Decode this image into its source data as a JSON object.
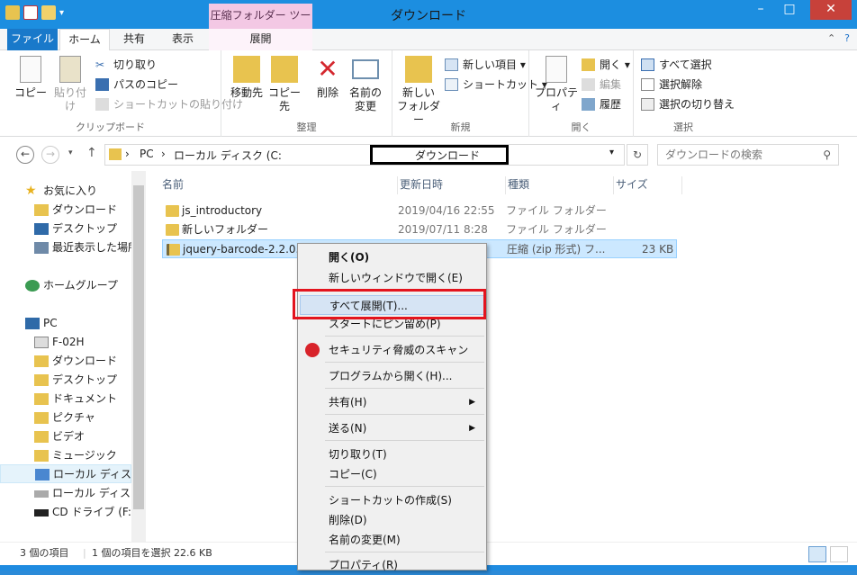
{
  "window": {
    "title": "ダウンロード",
    "context_tab_header": "圧縮フォルダー ツール"
  },
  "tabs": {
    "file": "ファイル",
    "home": "ホーム",
    "share": "共有",
    "view": "表示",
    "extract": "展開"
  },
  "ribbon": {
    "clipboard": {
      "label": "クリップボード",
      "copy": "コピー",
      "paste": "貼り付け",
      "cut": "切り取り",
      "copy_path": "パスのコピー",
      "paste_shortcut": "ショートカットの貼り付け"
    },
    "organize": {
      "label": "整理",
      "move_to": "移動先",
      "copy_to": "コピー先",
      "delete": "削除",
      "rename_l1": "名前の",
      "rename_l2": "変更"
    },
    "new": {
      "label": "新規",
      "new_folder_l1": "新しい",
      "new_folder_l2": "フォルダー",
      "new_item": "新しい項目",
      "shortcut": "ショートカット"
    },
    "open": {
      "label": "開く",
      "properties": "プロパティ",
      "open": "開く",
      "edit": "編集",
      "history": "履歴"
    },
    "select": {
      "label": "選択",
      "select_all": "すべて選択",
      "select_none": "選択解除",
      "invert": "選択の切り替え"
    }
  },
  "address": {
    "pc": "PC",
    "disk": "ローカル ディスク (C:",
    "folder": "ダウンロード",
    "search_placeholder": "ダウンロードの検索"
  },
  "nav": {
    "favorites": "お気に入り",
    "downloads": "ダウンロード",
    "desktop": "デスクトップ",
    "recent": "最近表示した場所",
    "homegroup": "ホームグループ",
    "pc": "PC",
    "f02h": "F-02H",
    "pc_downloads": "ダウンロード",
    "pc_desktop": "デスクトップ",
    "documents": "ドキュメント",
    "pictures": "ピクチャ",
    "videos": "ビデオ",
    "music": "ミュージック",
    "local_disk_1": "ローカル ディスク (",
    "local_disk_2": "ローカル ディスク (",
    "cd_drive": "CD ドライブ (F:)"
  },
  "columns": {
    "name": "名前",
    "date": "更新日時",
    "type": "種類",
    "size": "サイズ"
  },
  "files": [
    {
      "name": "js_introductory",
      "date": "2019/04/16 22:55",
      "type": "ファイル フォルダー",
      "size": ""
    },
    {
      "name": "新しいフォルダー",
      "date": "2019/07/11 8:28",
      "type": "ファイル フォルダー",
      "size": ""
    },
    {
      "name": "jquery-barcode-2.2.0.",
      "date": "",
      "type": "圧縮 (zip 形式) フ...",
      "size": "23 KB"
    }
  ],
  "status": {
    "count": "3 個の項目",
    "selected": "1 個の項目を選択  22.6 KB"
  },
  "context_menu": {
    "open": "開く(O)",
    "open_new_window": "新しいウィンドウで開く(E)",
    "extract_all": "すべて展開(T)...",
    "pin_start": "スタートにピン留め(P)",
    "security_scan": "セキュリティ脅威のスキャン",
    "open_with": "プログラムから開く(H)...",
    "share": "共有(H)",
    "send_to": "送る(N)",
    "cut": "切り取り(T)",
    "copy": "コピー(C)",
    "create_shortcut": "ショートカットの作成(S)",
    "delete": "削除(D)",
    "rename": "名前の変更(M)",
    "properties": "プロパティ(R)"
  }
}
